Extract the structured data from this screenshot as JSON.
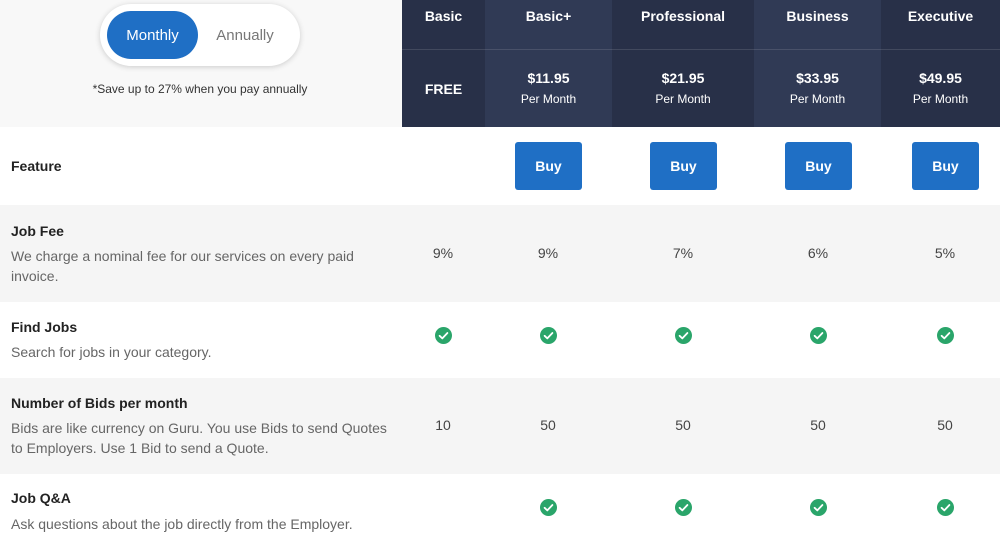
{
  "billing_toggle": {
    "monthly": "Monthly",
    "annually": "Annually",
    "selected": "Monthly"
  },
  "save_note": "*Save up to 27% when you pay annually",
  "plans": [
    {
      "name": "Basic",
      "price": "FREE",
      "per": ""
    },
    {
      "name": "Basic+",
      "price": "$11.95",
      "per": "Per Month"
    },
    {
      "name": "Professional",
      "price": "$21.95",
      "per": "Per Month"
    },
    {
      "name": "Business",
      "price": "$33.95",
      "per": "Per Month"
    },
    {
      "name": "Executive",
      "price": "$49.95",
      "per": "Per Month"
    }
  ],
  "feature_header": "Feature",
  "buy_label": "Buy",
  "features": [
    {
      "title": "Job Fee",
      "description": "We charge a nominal fee for our services on every paid invoice.",
      "values": [
        "9%",
        "9%",
        "7%",
        "6%",
        "5%"
      ]
    },
    {
      "title": "Find Jobs",
      "description": "Search for jobs in your category.",
      "values": [
        "check",
        "check",
        "check",
        "check",
        "check"
      ]
    },
    {
      "title": "Number of Bids per month",
      "description": "Bids are like currency on Guru. You use Bids to send Quotes to Employers. Use 1 Bid to send a Quote.",
      "values": [
        "10",
        "50",
        "50",
        "50",
        "50"
      ]
    },
    {
      "title": "Job Q&A",
      "description": "Ask questions about the job directly from the Employer.",
      "values": [
        "",
        "check",
        "check",
        "check",
        "check"
      ]
    }
  ],
  "colors": {
    "accent": "#1f6fc5",
    "header_dark": "#283048",
    "header_mid": "#303a55",
    "check": "#2aa56a"
  },
  "icons": {
    "check": "check-circle-icon"
  }
}
